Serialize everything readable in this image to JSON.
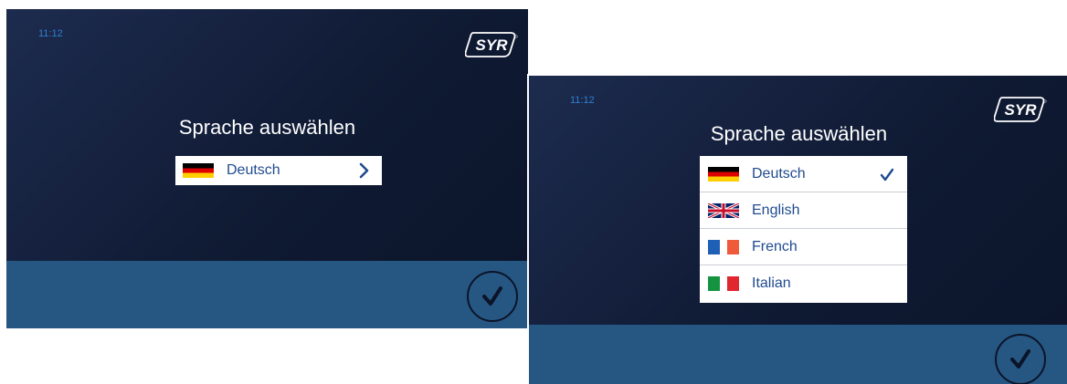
{
  "screen_a": {
    "time": "11:12",
    "brand": "SYR",
    "title": "Sprache auswählen",
    "selected_language": "Deutsch",
    "selected_flag": "flag-germany-icon",
    "open_icon": "chevron-right-icon",
    "confirm_icon": "check-icon"
  },
  "screen_b": {
    "time": "11:12",
    "brand": "SYR",
    "title": "Sprache auswählen",
    "languages": [
      {
        "label": "Deutsch",
        "flag": "flag-germany-icon",
        "selected": true
      },
      {
        "label": "English",
        "flag": "flag-uk-icon",
        "selected": false
      },
      {
        "label": "French",
        "flag": "flag-france-icon",
        "selected": false
      },
      {
        "label": "Italian",
        "flag": "flag-italy-icon",
        "selected": false
      }
    ],
    "confirm_icon": "check-icon"
  },
  "colors": {
    "background_dark": "#0f1a33",
    "bottom_bar": "#265783",
    "clock": "#2f7fd0",
    "list_text": "#1f4b8f",
    "title_text": "#ffffff"
  }
}
